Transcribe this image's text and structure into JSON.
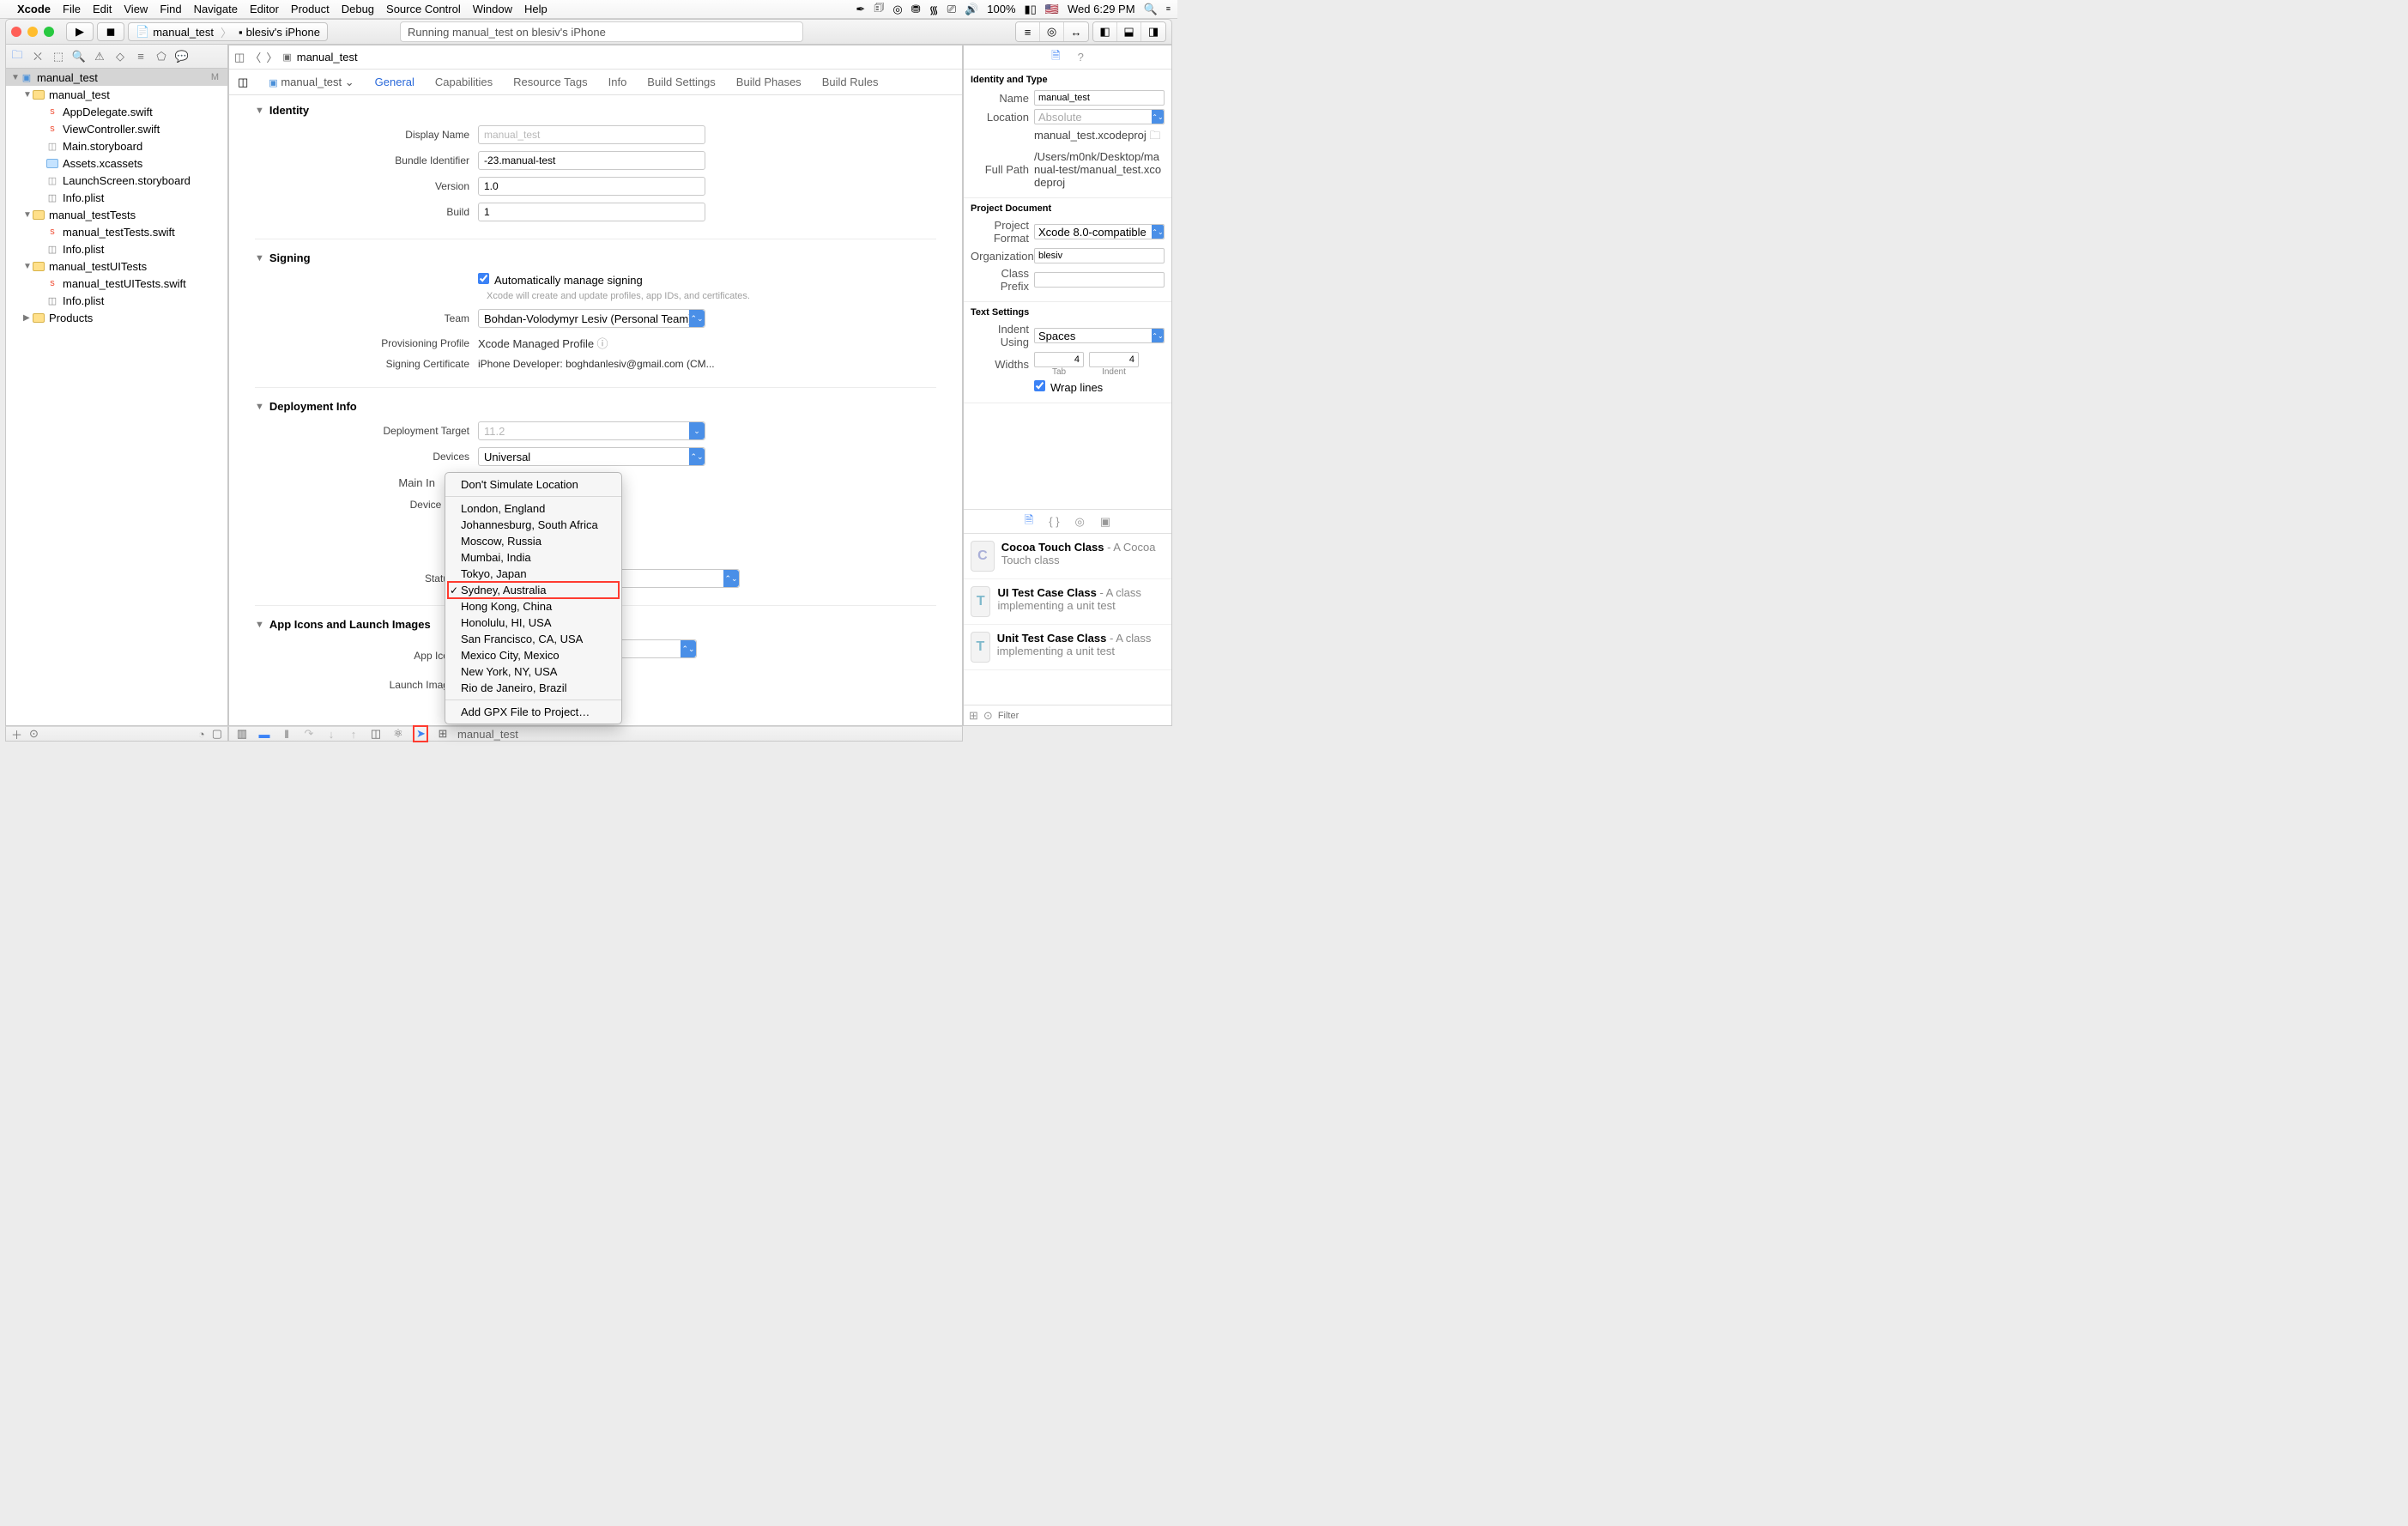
{
  "menubar": {
    "app": "Xcode",
    "items": [
      "File",
      "Edit",
      "View",
      "Find",
      "Navigate",
      "Editor",
      "Product",
      "Debug",
      "Source Control",
      "Window",
      "Help"
    ],
    "battery": "100%",
    "clock": "Wed 6:29 PM"
  },
  "toolbar": {
    "scheme_target": "manual_test",
    "scheme_device": "blesiv's iPhone",
    "activity": "Running manual_test on  blesiv's iPhone"
  },
  "navigator": {
    "root": "manual_test",
    "root_flag": "M",
    "groups": [
      {
        "name": "manual_test",
        "files": [
          "AppDelegate.swift",
          "ViewController.swift",
          "Main.storyboard",
          "Assets.xcassets",
          "LaunchScreen.storyboard",
          "Info.plist"
        ]
      },
      {
        "name": "manual_testTests",
        "files": [
          "manual_testTests.swift",
          "Info.plist"
        ]
      },
      {
        "name": "manual_testUITests",
        "files": [
          "manual_testUITests.swift",
          "Info.plist"
        ]
      },
      {
        "name": "Products",
        "files": []
      }
    ]
  },
  "jumpbar": {
    "file": "manual_test"
  },
  "tabs": {
    "crumb": "manual_test",
    "items": [
      "General",
      "Capabilities",
      "Resource Tags",
      "Info",
      "Build Settings",
      "Build Phases",
      "Build Rules"
    ],
    "active": "General"
  },
  "identity": {
    "title": "Identity",
    "display_name_label": "Display Name",
    "display_name_placeholder": "manual_test",
    "bundle_id_label": "Bundle Identifier",
    "bundle_id": "-23.manual-test",
    "version_label": "Version",
    "version": "1.0",
    "build_label": "Build",
    "build": "1"
  },
  "signing": {
    "title": "Signing",
    "auto_label": "Automatically manage signing",
    "auto_hint": "Xcode will create and update profiles, app IDs, and certificates.",
    "team_label": "Team",
    "team": "Bohdan-Volodymyr Lesiv (Personal Team)",
    "prov_label": "Provisioning Profile",
    "prov": "Xcode Managed Profile",
    "cert_label": "Signing Certificate",
    "cert": "iPhone Developer: boghdanlesiv@gmail.com (CM..."
  },
  "deployment": {
    "title": "Deployment Info",
    "target_label": "Deployment Target",
    "target_placeholder": "11.2",
    "devices_label": "Devices",
    "devices": "Universal",
    "main_interface_label": "Main Interface",
    "orientation_label": "Device Orientation",
    "statusbar_label": "Status Bar Style"
  },
  "appicons": {
    "title": "App Icons and Launch Images",
    "icons_label": "App Icons Source",
    "launch_label": "Launch Images Source"
  },
  "location_menu": {
    "header": "Don't Simulate Location",
    "items": [
      "London, England",
      "Johannesburg, South Africa",
      "Moscow, Russia",
      "Mumbai, India",
      "Tokyo, Japan",
      "Sydney, Australia",
      "Hong Kong, China",
      "Honolulu, HI, USA",
      "San Francisco, CA, USA",
      "Mexico City, Mexico",
      "New York, NY, USA",
      "Rio de Janeiro, Brazil"
    ],
    "selected": "Sydney, Australia",
    "footer": "Add GPX File to Project…"
  },
  "debugbar": {
    "process": "manual_test"
  },
  "inspector": {
    "identity_type": {
      "title": "Identity and Type",
      "name_label": "Name",
      "name": "manual_test",
      "location_label": "Location",
      "location": "Absolute",
      "location_path": "manual_test.xcodeproj",
      "fullpath_label": "Full Path",
      "fullpath": "/Users/m0nk/Desktop/manual-test/manual_test.xcodeproj"
    },
    "project_doc": {
      "title": "Project Document",
      "format_label": "Project Format",
      "format": "Xcode 8.0-compatible",
      "org_label": "Organization",
      "org": "blesiv",
      "prefix_label": "Class Prefix"
    },
    "text_settings": {
      "title": "Text Settings",
      "indent_label": "Indent Using",
      "indent": "Spaces",
      "widths_label": "Widths",
      "tab": "4",
      "indent_w": "4",
      "tab_sub": "Tab",
      "indent_sub": "Indent",
      "wrap_label": "Wrap lines"
    },
    "library": [
      {
        "icon": "C",
        "title": "Cocoa Touch Class",
        "desc": " - A Cocoa Touch class"
      },
      {
        "icon": "T",
        "title": "UI Test Case Class",
        "desc": " - A class implementing a unit test"
      },
      {
        "icon": "T",
        "title": "Unit Test Case Class",
        "desc": " - A class implementing a unit test"
      }
    ],
    "filter_placeholder": "Filter"
  }
}
